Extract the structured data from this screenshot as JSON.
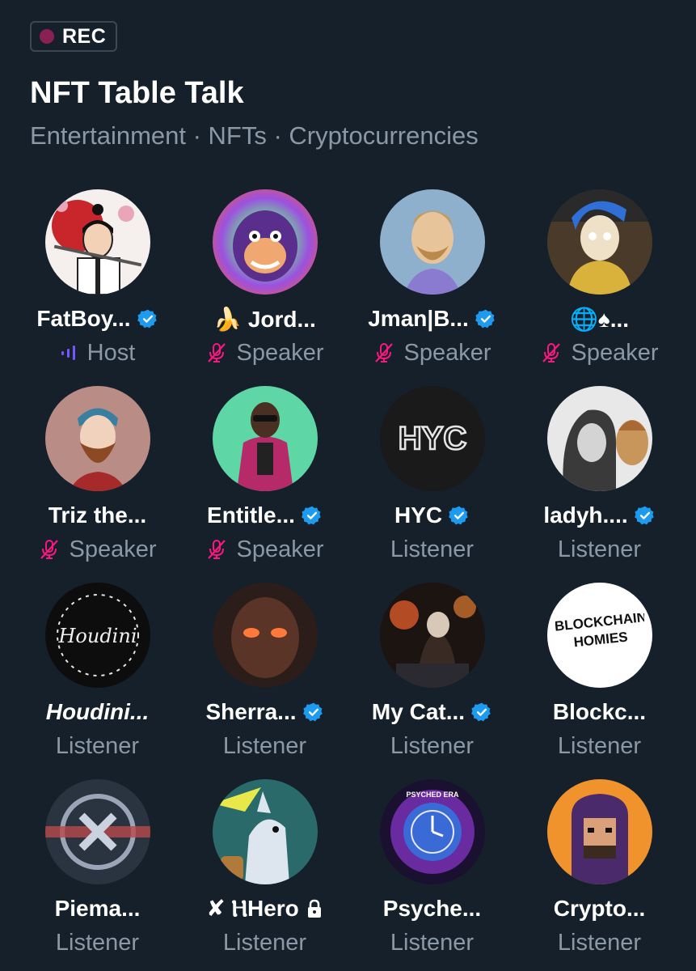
{
  "recording": {
    "label": "REC",
    "dot_color": "#8a2154"
  },
  "space": {
    "title": "NFT Table Talk",
    "topics": "Entertainment · NFTs · Cryptocurrencies"
  },
  "colors": {
    "verified": "#1d9bf0",
    "muted": "#f91880",
    "host_bars": "#7856ff",
    "secondary_text": "#8b98a5"
  },
  "participants": [
    {
      "name": "FatBoy...",
      "role": "Host",
      "verified": true,
      "role_icon": "host-audio-bars-icon"
    },
    {
      "name": "🍌 Jord...",
      "role": "Speaker",
      "verified": false,
      "role_icon": "mic-muted-icon"
    },
    {
      "name": "Jman|B...",
      "role": "Speaker",
      "verified": true,
      "role_icon": "mic-muted-icon"
    },
    {
      "name": "🌐♠...",
      "role": "Speaker",
      "verified": false,
      "role_icon": "mic-muted-icon"
    },
    {
      "name": "Triz the...",
      "role": "Speaker",
      "verified": false,
      "role_icon": "mic-muted-icon"
    },
    {
      "name": "Entitle...",
      "role": "Speaker",
      "verified": true,
      "role_icon": "mic-muted-icon"
    },
    {
      "name": "HYC",
      "role": "Listener",
      "verified": true,
      "avatar_text": "HYC"
    },
    {
      "name": "ladyh....",
      "role": "Listener",
      "verified": true
    },
    {
      "name": "Houdini...",
      "role": "Listener",
      "verified": false,
      "avatar_text": "Houdini"
    },
    {
      "name": "Sherra...",
      "role": "Listener",
      "verified": true
    },
    {
      "name": "My Cat...",
      "role": "Listener",
      "verified": true
    },
    {
      "name": "Blockc...",
      "role": "Listener",
      "verified": false,
      "avatar_text": "BLOCKCHAIN HOMIES"
    },
    {
      "name": "Piema...",
      "role": "Listener",
      "verified": false
    },
    {
      "name": "✘ ⲎHero",
      "role": "Listener",
      "verified": false,
      "protected": true
    },
    {
      "name": "Psyche...",
      "role": "Listener",
      "verified": false,
      "avatar_text": "PSYCHED ERA"
    },
    {
      "name": "Crypto...",
      "role": "Listener",
      "verified": false
    }
  ]
}
